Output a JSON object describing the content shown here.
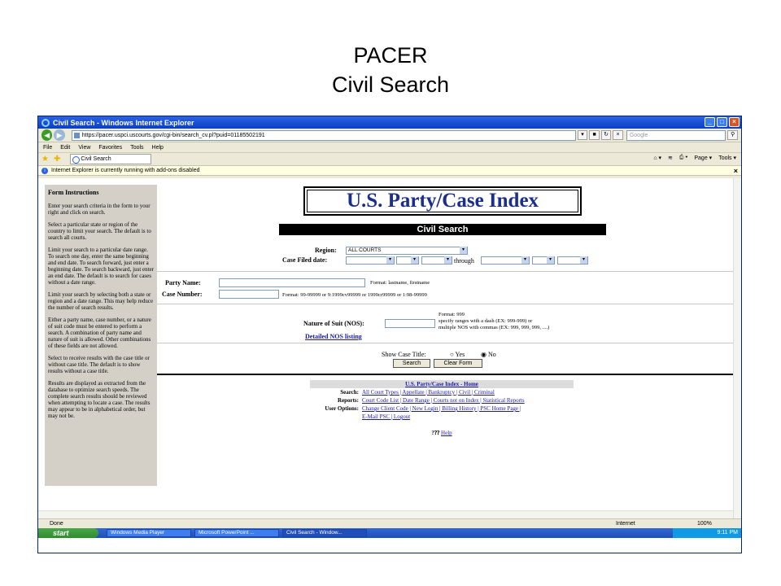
{
  "slide": {
    "title_line1": "PACER",
    "title_line2": "Civil Search"
  },
  "window": {
    "title": "Civil Search - Windows Internet Explorer",
    "url": "https://pacer.uspci.uscourts.gov/cgi-bin/search_cv.pl?puid=01185502191",
    "search_placeholder": "Google",
    "menu": [
      "File",
      "Edit",
      "View",
      "Favorites",
      "Tools",
      "Help"
    ],
    "tab_label": "Civil Search",
    "tools": [
      "Page ▾",
      "Tools ▾"
    ],
    "infobar": "Internet Explorer is currently running with add-ons disabled",
    "status_text": "Done",
    "zone": "Internet",
    "zoom": "100%"
  },
  "taskbar": {
    "start": "start",
    "tasks": [
      "Windows Media Player",
      "Microsoft PowerPoint ...",
      "Civil Search - Window..."
    ],
    "clock": "9:11 PM"
  },
  "sidebar": {
    "heading": "Form Instructions",
    "paragraphs": [
      "Enter your search criteria in the form to your right and click on search.",
      "Select a particular state or region of the country to limit your search. The default is to search all courts.",
      "Limit your search to a particular date range. To search one day, enter the same beginning and end date. To search forward, just enter a beginning date. To search backward, just enter an end date. The default is to search for cases without a date range.",
      "Limit your search by selecting both a state or region and a date range. This may help reduce the number of search results.",
      "Either a party name, case number, or a nature of suit code must be entered to perform a search. A combination of party name and nature of suit is allowed. Other combinations of these fields are not allowed.",
      "Select to receive results with the case title or without case title. The default is to show results without a case title.",
      "Results are displayed as extracted from the database to optimize search speeds. The complete search results should be reviewed when attempting to locate a case. The results may appear to be in alphabetical order, but may not be."
    ]
  },
  "form": {
    "logo": "U.S. Party/Case Index",
    "bar": "Civil Search",
    "region_label": "Region:",
    "region_value": "ALL COURTS",
    "filed_label": "Case Filed date:",
    "through": "through",
    "party_label": "Party Name:",
    "party_format": "Format: lastname, firstname",
    "case_label": "Case Number:",
    "case_format": "Format: 99-99999 or 9:1999cv99999 or 1999cr99999 or 1:98-99999",
    "nos_label": "Nature of Suit (NOS):",
    "nos_format_1": "Format: 999",
    "nos_format_2": "specify ranges with a dash (EX: 999-999) or",
    "nos_format_3": "multiple NOS with commas (EX: 999, 999, 999, ....)",
    "nos_link": "Detailed NOS listing",
    "show_title_label": "Show Case Title:",
    "yes": "Yes",
    "no": "No",
    "search_btn": "Search",
    "clear_btn": "Clear Form"
  },
  "footer": {
    "home": "U.S. Party/Case Index - Home",
    "search_label": "Search:",
    "search_links": "All Court Types | Appellate | Bankruptcy | Civil | Criminal",
    "reports_label": "Reports:",
    "reports_links": "Court Code List | Date Range | Courts not on Index | Statistical Reports",
    "user_label": "User Options:",
    "user_links": "Change Client Code | New Login | Billing History | PSC Home Page |",
    "user_links_2": "E-Mail PSC | Logout",
    "help": "Help"
  }
}
